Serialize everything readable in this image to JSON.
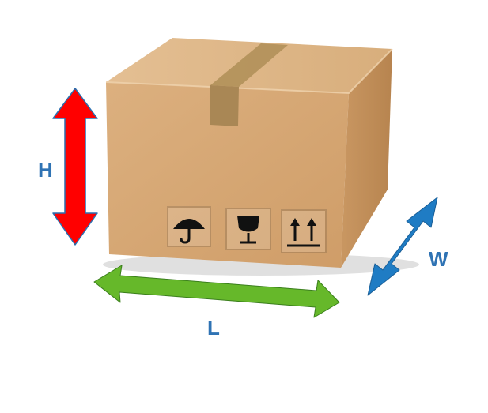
{
  "labels": {
    "height": "H",
    "length": "L",
    "width": "W"
  },
  "colors": {
    "height_arrow": "#ff0000",
    "length_arrow": "#66b82a",
    "width_arrow": "#1f7cc4",
    "label_text": "#2f73b4",
    "box_front": "#d9aa78",
    "box_top": "#e1b98c",
    "box_side": "#c79460",
    "tape": "#b5955f"
  },
  "icons": [
    "umbrella-icon",
    "fragile-glass-icon",
    "this-way-up-icon"
  ]
}
